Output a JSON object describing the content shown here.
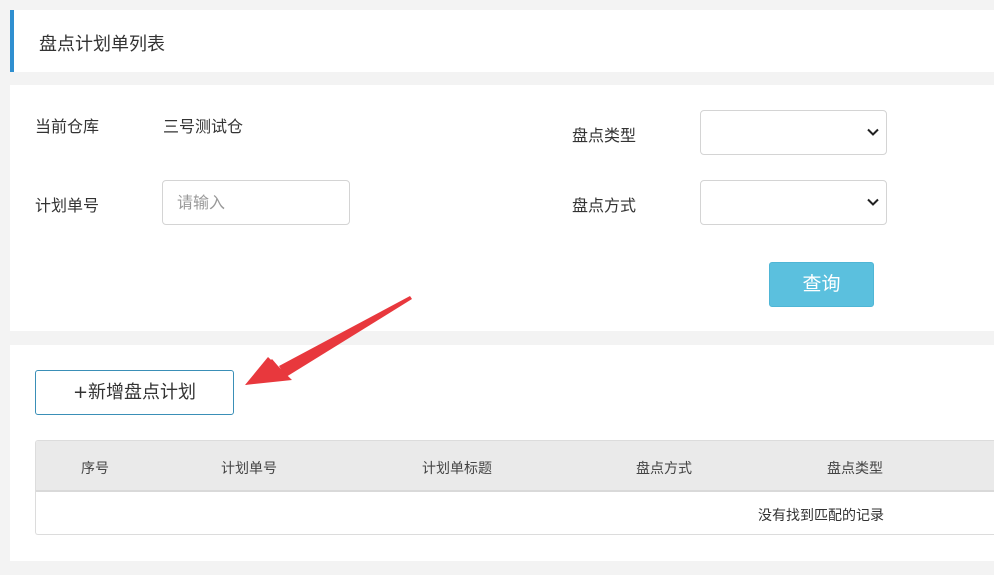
{
  "header": {
    "title": "盘点计划单列表"
  },
  "filters": {
    "warehouse_label": "当前仓库",
    "warehouse_value": "三号测试仓",
    "plan_no_label": "计划单号",
    "plan_no_placeholder": "请输入",
    "plan_no_value": "",
    "type_label": "盘点类型",
    "type_selected": "",
    "method_label": "盘点方式",
    "method_selected": "",
    "query_label": "查询"
  },
  "actions": {
    "add_label": "+新增盘点计划"
  },
  "table": {
    "columns": [
      "序号",
      "计划单号",
      "计划单标题",
      "盘点方式",
      "盘点类型"
    ],
    "rows": [],
    "empty_text": "没有找到匹配的记录"
  },
  "colors": {
    "accent": "#2f8fd0",
    "query_button": "#5bc0de",
    "annotation_arrow": "#e8383d"
  },
  "icons": {
    "select_chevron": "chevron-down-icon",
    "annotation": "red-arrow-icon"
  }
}
